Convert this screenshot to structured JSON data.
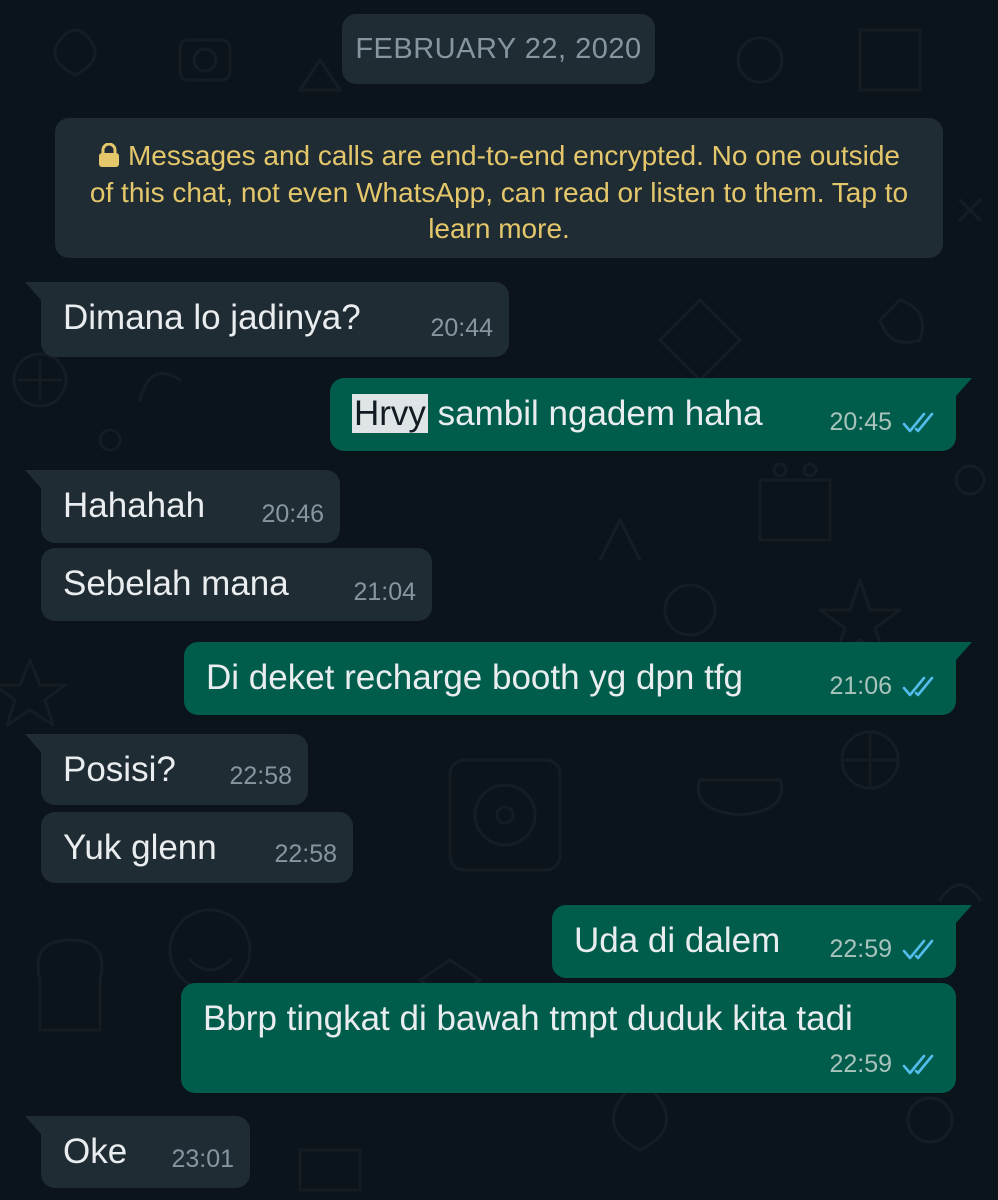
{
  "date_chip": "FEBRUARY 22, 2020",
  "encryption_notice": "Messages and calls are end-to-end encrypted. No one outside of this chat, not even WhatsApp, can read or listen to them. Tap to learn more.",
  "colors": {
    "background": "#0b141a",
    "incoming_bubble": "#202c33",
    "outgoing_bubble": "#005c4b",
    "notice_text": "#e5c76b",
    "read_ticks": "#53bdeb"
  },
  "messages": [
    {
      "text": "Dimana lo jadinya?",
      "time": "20:44",
      "direction": "incoming"
    },
    {
      "text_highlight": "Hrvy",
      "text": " sambil ngadem haha",
      "time": "20:45",
      "direction": "outgoing",
      "status": "read"
    },
    {
      "text": "Hahahah",
      "time": "20:46",
      "direction": "incoming"
    },
    {
      "text": "Sebelah mana",
      "time": "21:04",
      "direction": "incoming"
    },
    {
      "text": "Di deket recharge booth yg dpn tfg",
      "time": "21:06",
      "direction": "outgoing",
      "status": "read"
    },
    {
      "text": "Posisi?",
      "time": "22:58",
      "direction": "incoming"
    },
    {
      "text": "Yuk glenn",
      "time": "22:58",
      "direction": "incoming"
    },
    {
      "text": "Uda di dalem",
      "time": "22:59",
      "direction": "outgoing",
      "status": "read"
    },
    {
      "text": "Bbrp tingkat di bawah tmpt duduk kita tadi",
      "time": "22:59",
      "direction": "outgoing",
      "status": "read"
    },
    {
      "text": "Oke",
      "time": "23:01",
      "direction": "incoming"
    }
  ]
}
